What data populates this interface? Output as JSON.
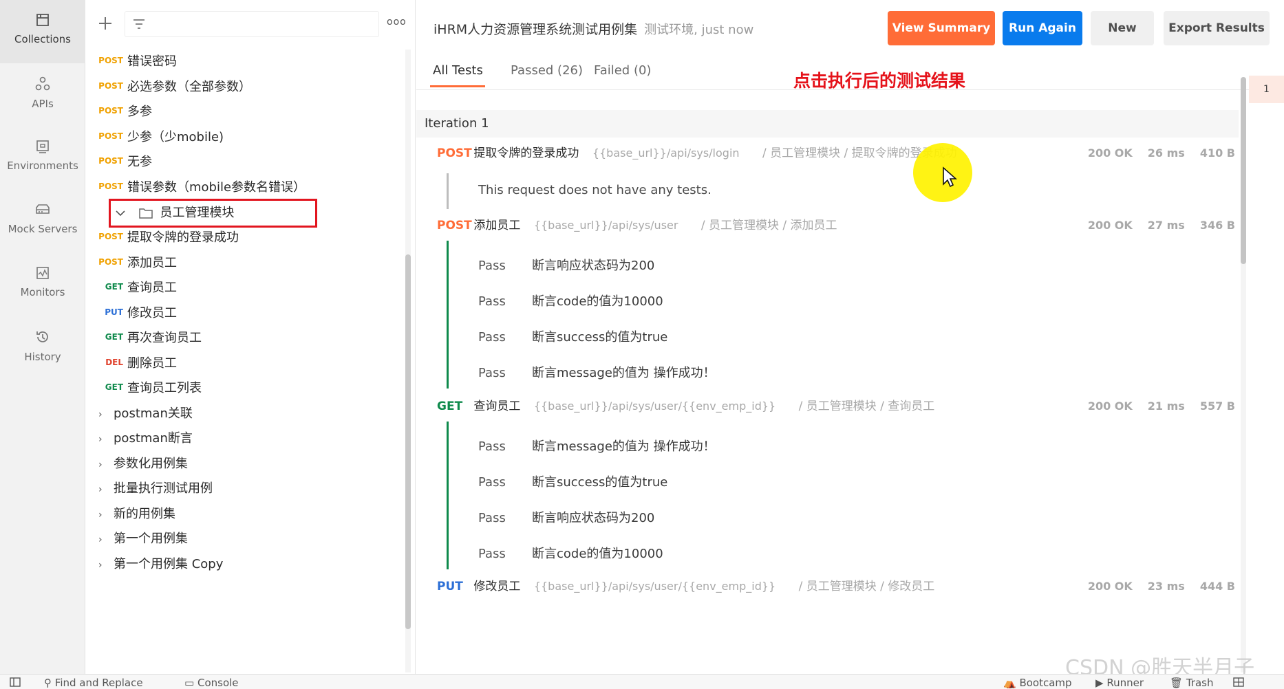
{
  "rail": [
    {
      "label": "Collections",
      "icon": "collections-icon"
    },
    {
      "label": "APIs",
      "icon": "apis-icon"
    },
    {
      "label": "Environments",
      "icon": "environments-icon"
    },
    {
      "label": "Mock Servers",
      "icon": "mock-servers-icon"
    },
    {
      "label": "Monitors",
      "icon": "monitors-icon"
    },
    {
      "label": "History",
      "icon": "history-icon"
    }
  ],
  "tree": {
    "toolbar": {
      "plus": "+",
      "more": "ooo"
    },
    "items": [
      {
        "method": "POST",
        "label": "错误密码"
      },
      {
        "method": "POST",
        "label": "必选参数（全部参数）"
      },
      {
        "method": "POST",
        "label": "多参"
      },
      {
        "method": "POST",
        "label": "少参（少mobile)"
      },
      {
        "method": "POST",
        "label": "无参"
      },
      {
        "method": "POST",
        "label": "错误参数（mobile参数名错误）"
      }
    ],
    "folder": {
      "label": "员工管理模块"
    },
    "folder_items": [
      {
        "method": "POST",
        "label": "提取令牌的登录成功"
      },
      {
        "method": "POST",
        "label": "添加员工"
      },
      {
        "method": "GET",
        "label": "查询员工"
      },
      {
        "method": "PUT",
        "label": "修改员工"
      },
      {
        "method": "GET",
        "label": "再次查询员工"
      },
      {
        "method": "DEL",
        "label": "删除员工"
      },
      {
        "method": "GET",
        "label": "查询员工列表"
      }
    ],
    "collections": [
      {
        "label": "postman关联"
      },
      {
        "label": "postman断言"
      },
      {
        "label": "参数化用例集"
      },
      {
        "label": "批量执行测试用例"
      },
      {
        "label": "新的用例集"
      },
      {
        "label": "第一个用例集"
      },
      {
        "label": "第一个用例集 Copy"
      }
    ]
  },
  "header": {
    "title": "iHRM人力资源管理系统测试用例集",
    "subtitle": "测试环境, just now",
    "buttons": {
      "summary": "View Summary",
      "run_again": "Run Again",
      "new": "New",
      "export": "Export Results"
    }
  },
  "tabs": [
    {
      "label": "All Tests"
    },
    {
      "label": "Passed (26)"
    },
    {
      "label": "Failed (0)"
    }
  ],
  "annotation": "点击执行后的测试结果",
  "iteration": {
    "label": "Iteration 1",
    "number": "1"
  },
  "requests": [
    {
      "method": "POST",
      "name": "提取令牌的登录成功",
      "url": "{{base_url}}/api/sys/login",
      "path": "/ 员工管理模块 / 提取令牌的登录成功",
      "status": "200 OK",
      "time": "26 ms",
      "size": "410 B",
      "no_tests": "This request does not have any tests."
    },
    {
      "method": "POST",
      "name": "添加员工",
      "url": "{{base_url}}/api/sys/user",
      "path": "/ 员工管理模块 / 添加员工",
      "status": "200 OK",
      "time": "27 ms",
      "size": "346 B",
      "tests": [
        {
          "status": "Pass",
          "name": "断言响应状态码为200"
        },
        {
          "status": "Pass",
          "name": "断言code的值为10000"
        },
        {
          "status": "Pass",
          "name": "断言success的值为true"
        },
        {
          "status": "Pass",
          "name": "断言message的值为 操作成功！"
        }
      ]
    },
    {
      "method": "GET",
      "name": "查询员工",
      "url": "{{base_url}}/api/sys/user/{{env_emp_id}}",
      "path": "/ 员工管理模块 / 查询员工",
      "status": "200 OK",
      "time": "21 ms",
      "size": "557 B",
      "tests": [
        {
          "status": "Pass",
          "name": "断言message的值为 操作成功！"
        },
        {
          "status": "Pass",
          "name": "断言success的值为true"
        },
        {
          "status": "Pass",
          "name": "断言响应状态码为200"
        },
        {
          "status": "Pass",
          "name": "断言code的值为10000"
        }
      ]
    },
    {
      "method": "PUT",
      "name": "修改员工",
      "url": "{{base_url}}/api/sys/user/{{env_emp_id}}",
      "path": "/ 员工管理模块 / 修改员工",
      "status": "200 OK",
      "time": "23 ms",
      "size": "444 B"
    }
  ],
  "watermark": "CSDN @胜天半月子",
  "statusbar": {
    "find_replace": "Find and Replace",
    "console": "Console",
    "bootcamp": "Bootcamp",
    "runner": "Runner",
    "trash": "Trash"
  },
  "colors": {
    "accent": "#ff6c37",
    "primary": "#097bed",
    "pass": "#0f8a4c",
    "annotation": "#e5121a",
    "post": "#f0a100",
    "get": "#0f8a4c",
    "put": "#2c6fd6",
    "del": "#e0412c"
  }
}
